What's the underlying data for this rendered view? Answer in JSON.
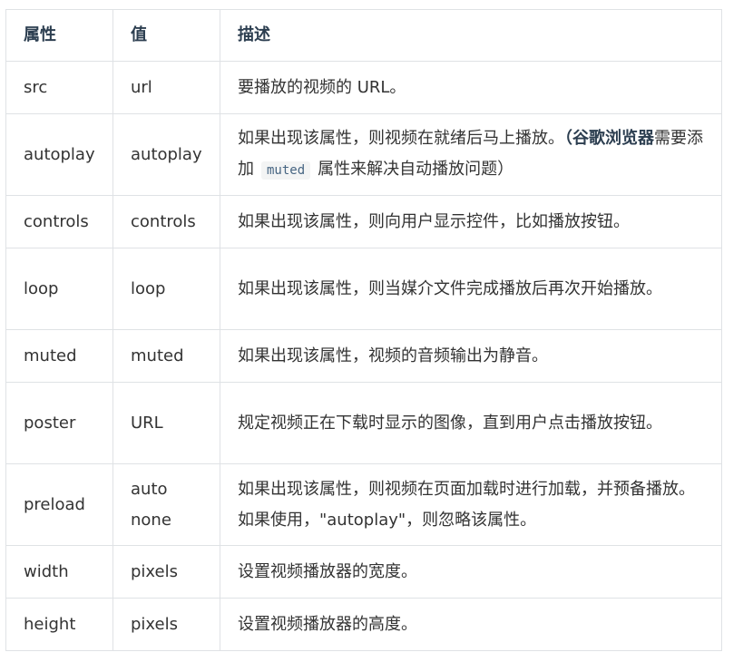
{
  "headers": [
    "属性",
    "值",
    "描述"
  ],
  "rows": [
    {
      "attr": "src",
      "value": "url",
      "desc": "要播放的视频的 URL。"
    },
    {
      "attr": "autoplay",
      "value": "autoplay",
      "desc_pre": "如果出现该属性，则视频在就绪后马上播放。",
      "desc_bold_1": "（谷歌浏览器",
      "desc_mid": "需要添加",
      "desc_code": "muted",
      "desc_post": "属性来解决自动播放问题）"
    },
    {
      "attr": "controls",
      "value": "controls",
      "desc": "如果出现该属性，则向用户显示控件，比如播放按钮。"
    },
    {
      "attr": "loop",
      "value": "loop",
      "desc": "如果出现该属性，则当媒介文件完成播放后再次开始播放。"
    },
    {
      "attr": "muted",
      "value": "muted",
      "desc": "如果出现该属性，视频的音频输出为静音。"
    },
    {
      "attr": "poster",
      "value": "URL",
      "desc": "规定视频正在下载时显示的图像，直到用户点击播放按钮。"
    },
    {
      "attr": "preload",
      "values": [
        "auto",
        "none"
      ],
      "desc": "如果出现该属性，则视频在页面加载时进行加载，并预备播放。如果使用，\"autoplay\"，则忽略该属性。"
    },
    {
      "attr": "width",
      "value": "pixels",
      "desc": "设置视频播放器的宽度。"
    },
    {
      "attr": "height",
      "value": "pixels",
      "desc": "设置视频播放器的高度。"
    }
  ]
}
